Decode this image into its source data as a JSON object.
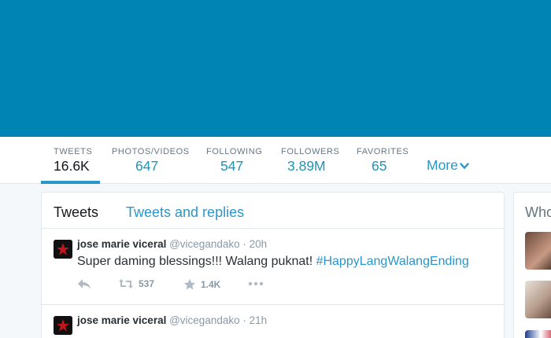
{
  "profile": {
    "stats": [
      {
        "label": "TWEETS",
        "value": "16.6K"
      },
      {
        "label": "PHOTOS/VIDEOS",
        "value": "647"
      },
      {
        "label": "FOLLOWING",
        "value": "547"
      },
      {
        "label": "FOLLOWERS",
        "value": "3.89M"
      },
      {
        "label": "FAVORITES",
        "value": "65"
      }
    ],
    "more_label": "More"
  },
  "timeline": {
    "tabs": [
      "Tweets",
      "Tweets and replies"
    ],
    "tweets": [
      {
        "name": "jose marie viceral",
        "handle": "@vicegandako",
        "separator": "·",
        "time": "20h",
        "text": "Super daming blessings!!! Walang puknat! ",
        "hashtag": "#HappyLangWalangEnding",
        "retweets": "537",
        "favorites": "1.4K"
      },
      {
        "name": "jose marie viceral",
        "handle": "@vicegandako",
        "separator": "·",
        "time": "21h"
      }
    ]
  },
  "sidebar": {
    "who_to_follow_title": "Who"
  },
  "colors": {
    "banner": "#0084b4",
    "accent": "#2b95c9"
  }
}
